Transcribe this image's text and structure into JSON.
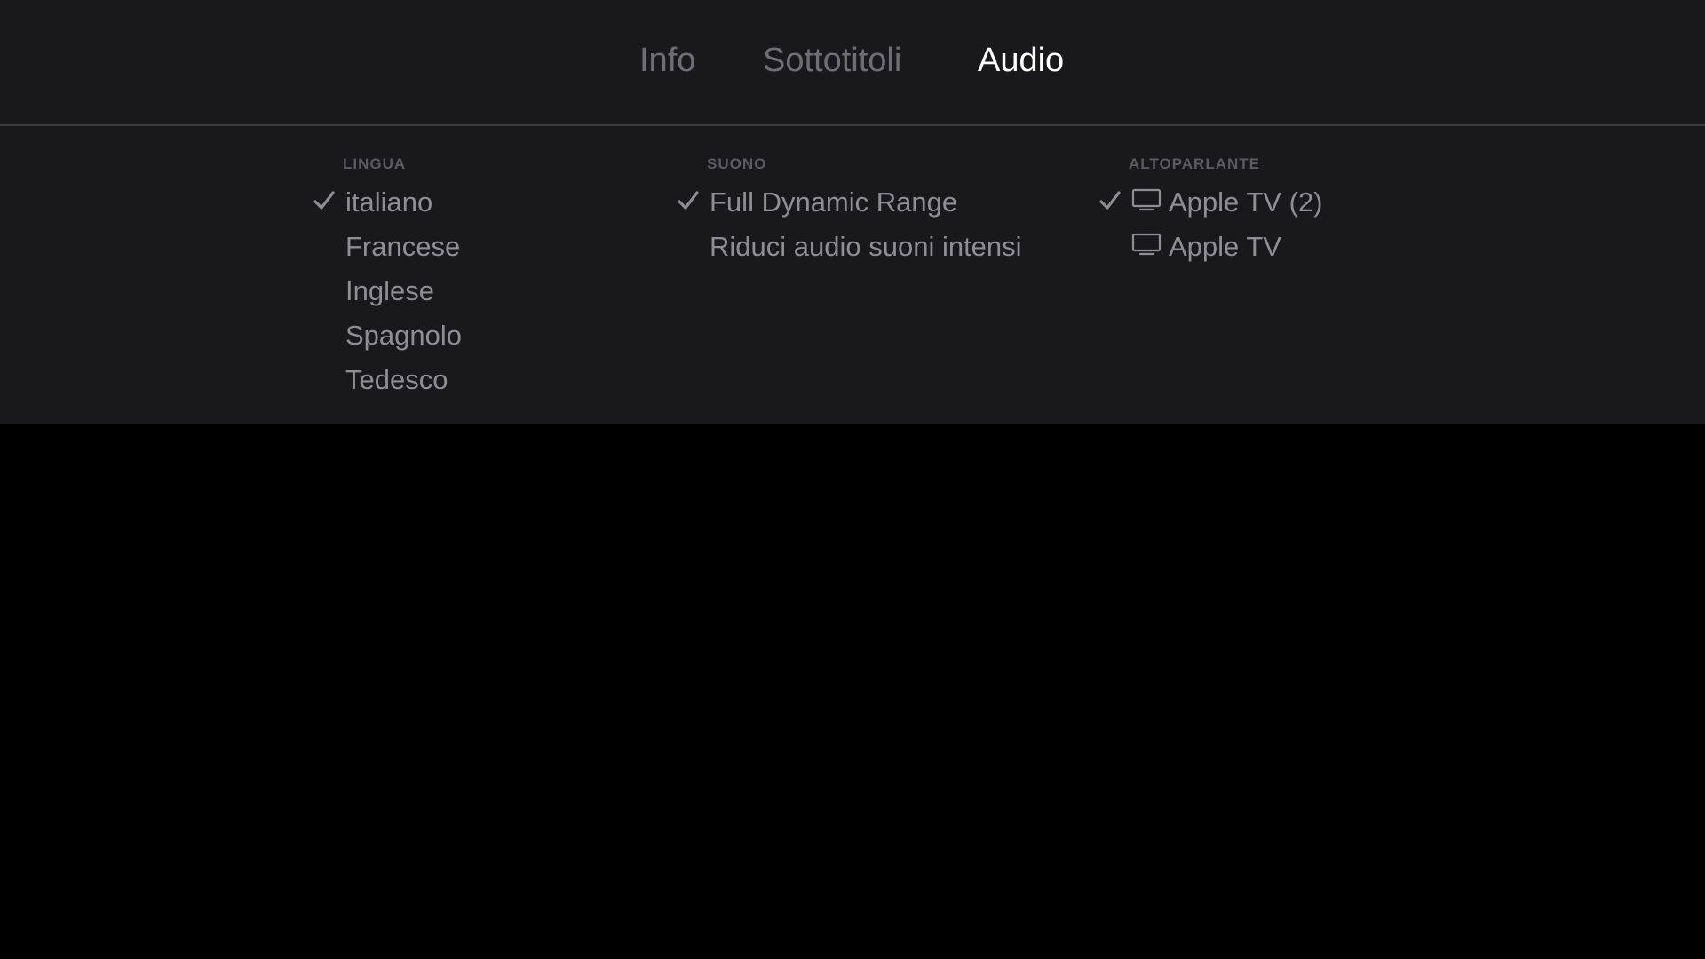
{
  "tabs": [
    {
      "label": "Info",
      "active": false
    },
    {
      "label": "Sottotitoli",
      "active": false
    },
    {
      "label": "Audio",
      "active": true
    }
  ],
  "sections": {
    "lingua": {
      "header": "LINGUA",
      "options": [
        {
          "label": "italiano",
          "selected": true
        },
        {
          "label": "Francese",
          "selected": false
        },
        {
          "label": "Inglese",
          "selected": false
        },
        {
          "label": "Spagnolo",
          "selected": false
        },
        {
          "label": "Tedesco",
          "selected": false
        }
      ]
    },
    "suono": {
      "header": "SUONO",
      "options": [
        {
          "label": "Full Dynamic Range",
          "selected": true
        },
        {
          "label": "Riduci audio suoni intensi",
          "selected": false
        }
      ]
    },
    "altoparlante": {
      "header": "ALTOPARLANTE",
      "options": [
        {
          "label": "Apple TV (2)",
          "selected": true,
          "icon": "tv-icon"
        },
        {
          "label": "Apple TV",
          "selected": false,
          "icon": "tv-icon"
        }
      ]
    }
  },
  "colors": {
    "panel_background": "#19191b",
    "page_background": "#000000",
    "active_tab": "#ffffff",
    "inactive_tab": "#6e6e73",
    "option_text": "#8e8e93",
    "section_header": "#5b5b60"
  }
}
